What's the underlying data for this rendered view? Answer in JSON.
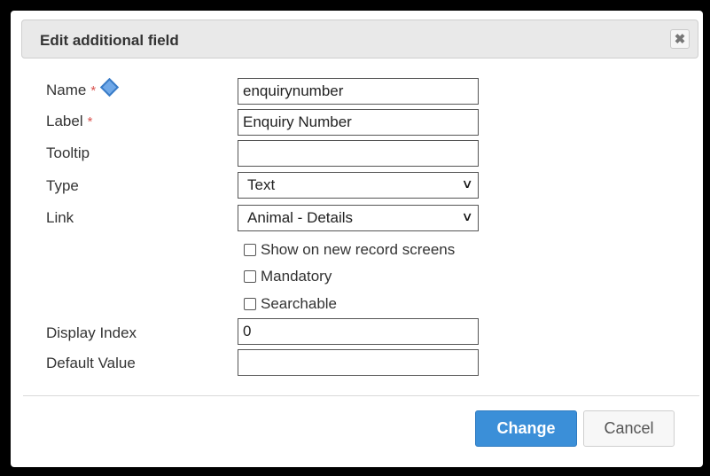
{
  "dialog": {
    "title": "Edit additional field",
    "close_icon": "close-icon"
  },
  "form": {
    "name": {
      "label": "Name",
      "required_marker": "*",
      "value": "enquirynumber"
    },
    "label": {
      "label": "Label",
      "required_marker": "*",
      "value": "Enquiry Number"
    },
    "tooltip": {
      "label": "Tooltip",
      "value": ""
    },
    "type": {
      "label": "Type",
      "selected": "Text"
    },
    "link": {
      "label": "Link",
      "selected": "Animal - Details"
    },
    "checkboxes": [
      {
        "label": "Show on new record screens",
        "checked": false
      },
      {
        "label": "Mandatory",
        "checked": false
      },
      {
        "label": "Searchable",
        "checked": false
      }
    ],
    "display_index": {
      "label": "Display Index",
      "value": "0"
    },
    "default_value": {
      "label": "Default Value",
      "value": ""
    }
  },
  "buttons": {
    "change": "Change",
    "cancel": "Cancel"
  }
}
